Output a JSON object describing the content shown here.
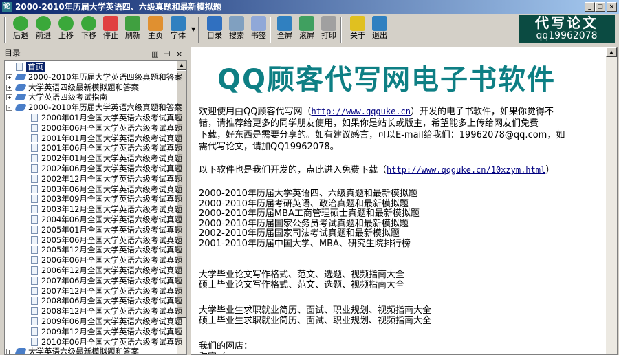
{
  "window": {
    "title": "2000-2010年历届大学英语四、六级真题和最新模拟题",
    "icon_char": "论",
    "min": "_",
    "max": "□",
    "close": "×"
  },
  "toolbar": [
    {
      "label": "后退",
      "icon": "back-icon",
      "color": "#3aa83a"
    },
    {
      "label": "前进",
      "icon": "forward-icon",
      "color": "#3aa83a"
    },
    {
      "label": "上移",
      "icon": "up-icon",
      "color": "#3aa83a"
    },
    {
      "label": "下移",
      "icon": "down-icon",
      "color": "#3aa83a"
    },
    {
      "label": "停止",
      "icon": "stop-icon",
      "color": "#e04040"
    },
    {
      "label": "刷新",
      "icon": "refresh-icon",
      "color": "#40a040"
    },
    {
      "label": "主页",
      "icon": "home-icon",
      "color": "#e09030"
    },
    {
      "label": "字体",
      "icon": "font-icon",
      "color": "#3080c0"
    },
    {
      "label": "目录",
      "icon": "contents-icon",
      "color": "#3070c0"
    },
    {
      "label": "搜索",
      "icon": "search-icon",
      "color": "#80a0c0"
    },
    {
      "label": "书签",
      "icon": "bookmark-icon",
      "color": "#90a8d8"
    },
    {
      "label": "全屏",
      "icon": "fullscreen-icon",
      "color": "#3080c0"
    },
    {
      "label": "滚屏",
      "icon": "scroll-icon",
      "color": "#40a060"
    },
    {
      "label": "打印",
      "icon": "print-icon",
      "color": "#a0a0a0"
    },
    {
      "label": "关于",
      "icon": "about-icon",
      "color": "#e0c020"
    },
    {
      "label": "退出",
      "icon": "exit-icon",
      "color": "#3080c0"
    }
  ],
  "logo": {
    "line1": "代写论文",
    "line2": "qq19962078"
  },
  "panel": {
    "title": "目录",
    "ctl1": "▥",
    "ctl2": "⊣",
    "ctl3": "×"
  },
  "tree": [
    {
      "label": "首页",
      "type": "doc",
      "level": 0,
      "selected": true
    },
    {
      "label": "2000-2010年历届大学英语四级真题和答案",
      "type": "book",
      "level": 0,
      "pm": "+"
    },
    {
      "label": "大学英语四级最新模拟题和答案",
      "type": "book",
      "level": 0,
      "pm": "+"
    },
    {
      "label": "大学英语四级考试指南",
      "type": "book",
      "level": 0,
      "pm": "+"
    },
    {
      "label": "2000-2010年历届大学英语六级真题和答案",
      "type": "book",
      "level": 0,
      "pm": "-"
    },
    {
      "label": "2000年01月全国大学英语六级考试真题",
      "type": "doc",
      "level": 1
    },
    {
      "label": "2000年06月全国大学英语六级考试真题",
      "type": "doc",
      "level": 1
    },
    {
      "label": "2001年01月全国大学英语六级考试真题",
      "type": "doc",
      "level": 1
    },
    {
      "label": "2001年06月全国大学英语六级考试真题",
      "type": "doc",
      "level": 1
    },
    {
      "label": "2002年01月全国大学英语六级考试真题",
      "type": "doc",
      "level": 1
    },
    {
      "label": "2002年06月全国大学英语六级考试真题",
      "type": "doc",
      "level": 1
    },
    {
      "label": "2002年12月全国大学英语六级考试真题",
      "type": "doc",
      "level": 1
    },
    {
      "label": "2003年06月全国大学英语六级考试真题",
      "type": "doc",
      "level": 1
    },
    {
      "label": "2003年09月全国大学英语六级考试真题",
      "type": "doc",
      "level": 1
    },
    {
      "label": "2003年12月全国大学英语六级考试真题",
      "type": "doc",
      "level": 1
    },
    {
      "label": "2004年06月全国大学英语六级考试真题",
      "type": "doc",
      "level": 1
    },
    {
      "label": "2005年01月全国大学英语六级考试真题",
      "type": "doc",
      "level": 1
    },
    {
      "label": "2005年06月全国大学英语六级考试真题",
      "type": "doc",
      "level": 1
    },
    {
      "label": "2005年12月全国大学英语六级考试真题",
      "type": "doc",
      "level": 1
    },
    {
      "label": "2006年06月全国大学英语六级考试真题",
      "type": "doc",
      "level": 1
    },
    {
      "label": "2006年12月全国大学英语六级考试真题",
      "type": "doc",
      "level": 1
    },
    {
      "label": "2007年06月全国大学英语六级考试真题",
      "type": "doc",
      "level": 1
    },
    {
      "label": "2007年12月全国大学英语六级考试真题",
      "type": "doc",
      "level": 1
    },
    {
      "label": "2008年06月全国大学英语六级考试真题",
      "type": "doc",
      "level": 1
    },
    {
      "label": "2008年12月全国大学英语六级考试真题",
      "type": "doc",
      "level": 1
    },
    {
      "label": "2009年06月全国大学英语六级考试真题",
      "type": "doc",
      "level": 1
    },
    {
      "label": "2009年12月全国大学英语六级考试真题",
      "type": "doc",
      "level": 1
    },
    {
      "label": "2010年06月全国大学英语六级考试真题",
      "type": "doc",
      "level": 1
    },
    {
      "label": "大学英语六级最新模拟题和答案",
      "type": "book",
      "level": 0,
      "pm": "+"
    }
  ],
  "content": {
    "heading": "QQ顾客代写网电子书软件",
    "p1": [
      {
        "t": "欢迎使用由QQ顾客代写网（",
        "link": "http://www.qqguke.cn",
        "after": "）开发的电子书软件，如果你觉得不"
      },
      {
        "t": "错，请推荐给更多的同学朋友使用，如果你是站长或版主，希望能多上传给网友们免费"
      },
      {
        "t": "下载，好东西是需要分享的。如有建议感言，可以E-mail给我们：19962078@qq.com，如"
      },
      {
        "t": "需代写论文，请加QQ19962078。"
      }
    ],
    "p2": {
      "t": "以下软件也是我们开发的，点此进入免费下载（",
      "link": "http://www.qqguke.cn/10xzym.html",
      "after": "）"
    },
    "list1": [
      "2000-2010年历届大学英语四、六级真题和最新模拟题",
      "2000-2010年历届考研英语、政治真题和最新模拟题",
      "2000-2010年历届MBA工商管理硕士真题和最新模拟题",
      "2000-2010年历届国家公务员考试真题和最新模拟题",
      "2002-2010年历届国家司法考试真题和最新模拟题",
      "2001-2010年历届中国大学、MBA、研究生院排行榜"
    ],
    "list2": [
      "大学毕业论文写作格式、范文、选题、视频指南大全",
      "硕士毕业论文写作格式、范文、选题、视频指南大全"
    ],
    "list3": [
      "大学毕业生求职就业简历、面试、职业规划、视频指南大全",
      "硕士毕业生求职就业简历、面试、职业规划、视频指南大全"
    ],
    "shop": "我们的网店：",
    "shop2": "淘宝（"
  }
}
